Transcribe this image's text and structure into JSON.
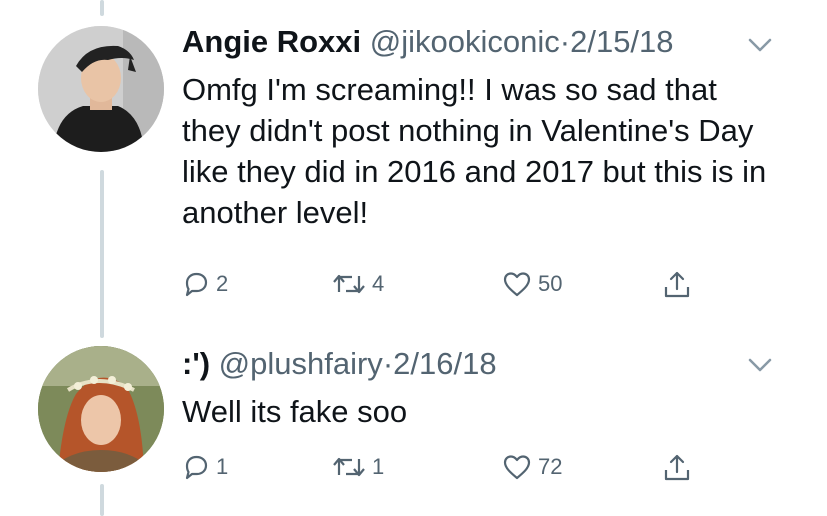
{
  "tweets": [
    {
      "display_name": "Angie Roxxi",
      "handle": "@jikookiconic",
      "separator": "·",
      "date": "2/15/18",
      "text": "Omfg I'm screaming!! I was so sad that they didn't post nothing in Valentine's Day like they did in 2016 and 2017 but this is in another level!",
      "replies": "2",
      "retweets": "4",
      "likes": "50"
    },
    {
      "display_name": ":')",
      "handle": "@plushfairy",
      "separator": "·",
      "date": "2/16/18",
      "text": "Well its fake soo",
      "replies": "1",
      "retweets": "1",
      "likes": "72"
    }
  ],
  "icons": [
    "reply-icon",
    "retweet-icon",
    "like-icon",
    "share-icon",
    "chevron-down-icon"
  ],
  "colors": {
    "icon_gray": "#536471",
    "thread_line": "#cfd9de",
    "text": "#0f1419"
  }
}
